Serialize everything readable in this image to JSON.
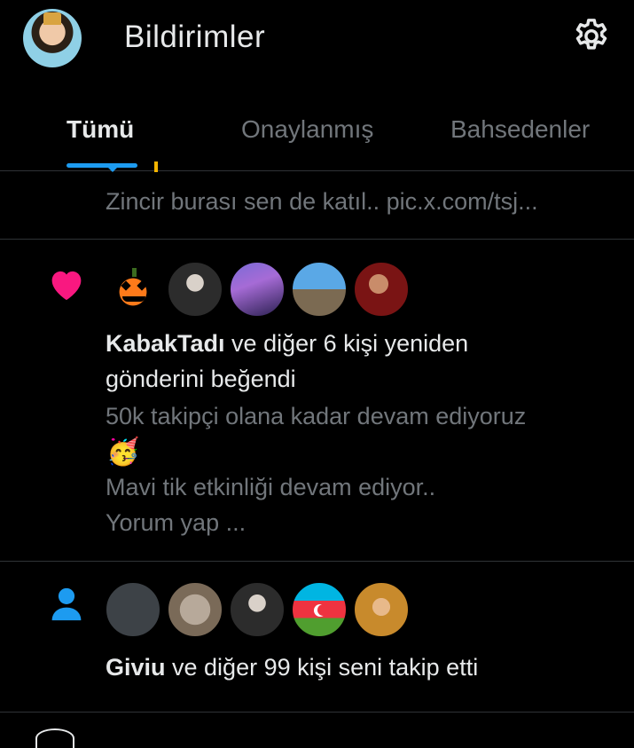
{
  "header": {
    "title": "Bildirimler"
  },
  "tabs": [
    {
      "label": "Tümü",
      "active": true
    },
    {
      "label": "Onaylanmış",
      "active": false
    },
    {
      "label": "Bahsedenler",
      "active": false
    }
  ],
  "notifications": [
    {
      "type": "partial",
      "snippet": "Zincir burası sen de katıl.. pic.x.com/tsj..."
    },
    {
      "type": "like",
      "icon": "heart-icon",
      "icon_color": "#f91880",
      "actor": "KabakTadı",
      "action_line1": " ve diğer 6 kişi yeniden",
      "action_line2": "gönderini beğendi",
      "post_line1": "50k takipçi olana kadar devam ediyoruz",
      "post_emoji": "🥳",
      "post_line2": "Mavi tik etkinliği devam ediyor..",
      "post_line3": "Yorum yap ..."
    },
    {
      "type": "follow",
      "icon": "person-icon",
      "icon_color": "#1d9bf0",
      "actor": "Giviu",
      "action": " ve diğer 99 kişi seni takip etti"
    }
  ],
  "colors": {
    "background": "#000000",
    "text": "#e7e9ea",
    "muted": "#71767b",
    "accent": "#1d9bf0",
    "like": "#f91880",
    "divider": "#2f3336"
  }
}
